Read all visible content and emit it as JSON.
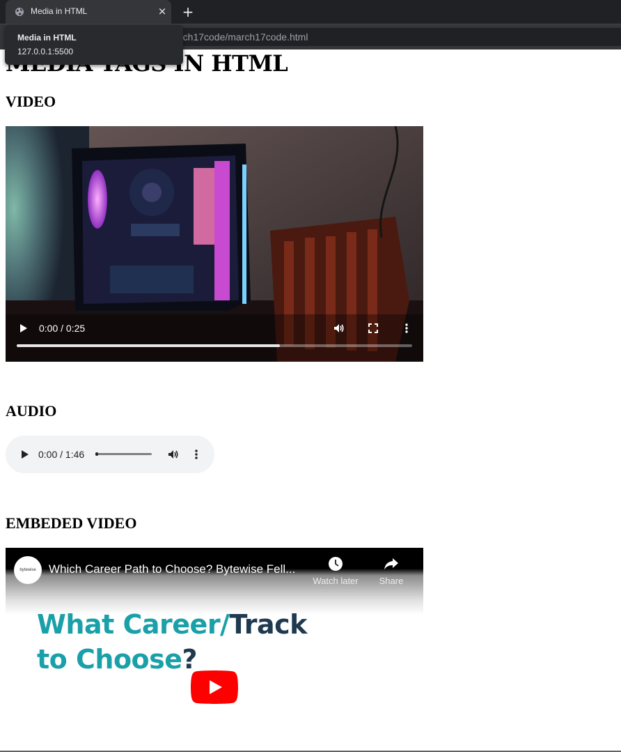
{
  "browser": {
    "tab": {
      "title": "Media in HTML",
      "favicon": "globe-icon",
      "close": "×"
    },
    "new_tab": "+",
    "url_visible": "rch17code/march17code.html",
    "tooltip": {
      "title": "Media in HTML",
      "url": "127.0.0.1:5500"
    }
  },
  "page": {
    "heading": "MEDIA TAGS IN HTML",
    "video_section": {
      "heading": "VIDEO",
      "player": {
        "time": "0:00 / 0:25",
        "progress": 0.665,
        "icons": [
          "play-icon",
          "volume-icon",
          "fullscreen-icon",
          "more-options-icon"
        ]
      }
    },
    "audio_section": {
      "heading": "AUDIO",
      "player": {
        "time": "0:00 / 1:46",
        "progress": 0.0,
        "icons": [
          "play-icon",
          "volume-icon",
          "more-options-icon"
        ]
      }
    },
    "embed_section": {
      "heading": "EMBEDED VIDEO",
      "player": {
        "channel_avatar_text": "bytewise",
        "title": "Which Career Path to Choose? Bytewise Fell...",
        "watch_later": "Watch later",
        "share": "Share",
        "thumbnail_line1_a": "What Career/",
        "thumbnail_line1_b": "Track",
        "thumbnail_line2_a": "to Choose",
        "thumbnail_line2_b": "?",
        "play_button_color": "#ff0000"
      }
    }
  }
}
